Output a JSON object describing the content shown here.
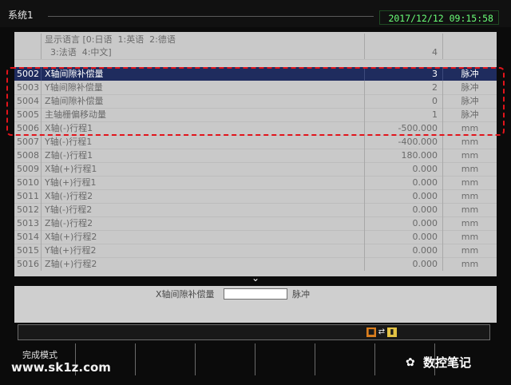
{
  "topbar": {
    "title": "系统1",
    "datetime": "2017/12/12  09:15:58"
  },
  "params": [
    {
      "no": "",
      "name": "显示语言 [0:日语  1:英语  2:德语\n  3:法语  4:中文]",
      "value": "4",
      "unit": ""
    },
    {
      "no": "5002",
      "name": "X轴间隙补偿量",
      "value": "3",
      "unit": "脉冲"
    },
    {
      "no": "5003",
      "name": "Y轴间隙补偿量",
      "value": "2",
      "unit": "脉冲"
    },
    {
      "no": "5004",
      "name": "Z轴间隙补偿量",
      "value": "0",
      "unit": "脉冲"
    },
    {
      "no": "5005",
      "name": "主轴栅偏移动量",
      "value": "1",
      "unit": "脉冲"
    },
    {
      "no": "5006",
      "name": "X轴(-)行程1",
      "value": "-500.000",
      "unit": "mm"
    },
    {
      "no": "5007",
      "name": "Y轴(-)行程1",
      "value": "-400.000",
      "unit": "mm"
    },
    {
      "no": "5008",
      "name": "Z轴(-)行程1",
      "value": "180.000",
      "unit": "mm"
    },
    {
      "no": "5009",
      "name": "X轴(+)行程1",
      "value": "0.000",
      "unit": "mm"
    },
    {
      "no": "5010",
      "name": "Y轴(+)行程1",
      "value": "0.000",
      "unit": "mm"
    },
    {
      "no": "5011",
      "name": "X轴(-)行程2",
      "value": "0.000",
      "unit": "mm"
    },
    {
      "no": "5012",
      "name": "Y轴(-)行程2",
      "value": "0.000",
      "unit": "mm"
    },
    {
      "no": "5013",
      "name": "Z轴(-)行程2",
      "value": "0.000",
      "unit": "mm"
    },
    {
      "no": "5014",
      "name": "X轴(+)行程2",
      "value": "0.000",
      "unit": "mm"
    },
    {
      "no": "5015",
      "name": "Y轴(+)行程2",
      "value": "0.000",
      "unit": "mm"
    },
    {
      "no": "5016",
      "name": "Z轴(+)行程2",
      "value": "0.000",
      "unit": "mm"
    }
  ],
  "selected_row": "5002",
  "edit": {
    "label": "X轴间隙补偿量",
    "value": "",
    "unit": "脉冲"
  },
  "softkeys": [
    "完成模式",
    "",
    "",
    "",
    "",
    "",
    "",
    ""
  ],
  "watermark": {
    "left": "www.sk1z.com",
    "right": "数控笔记"
  },
  "colors": {
    "highlight": "#1f2c5e",
    "annotation": "#e2141b",
    "datetime": "#6aff78"
  }
}
